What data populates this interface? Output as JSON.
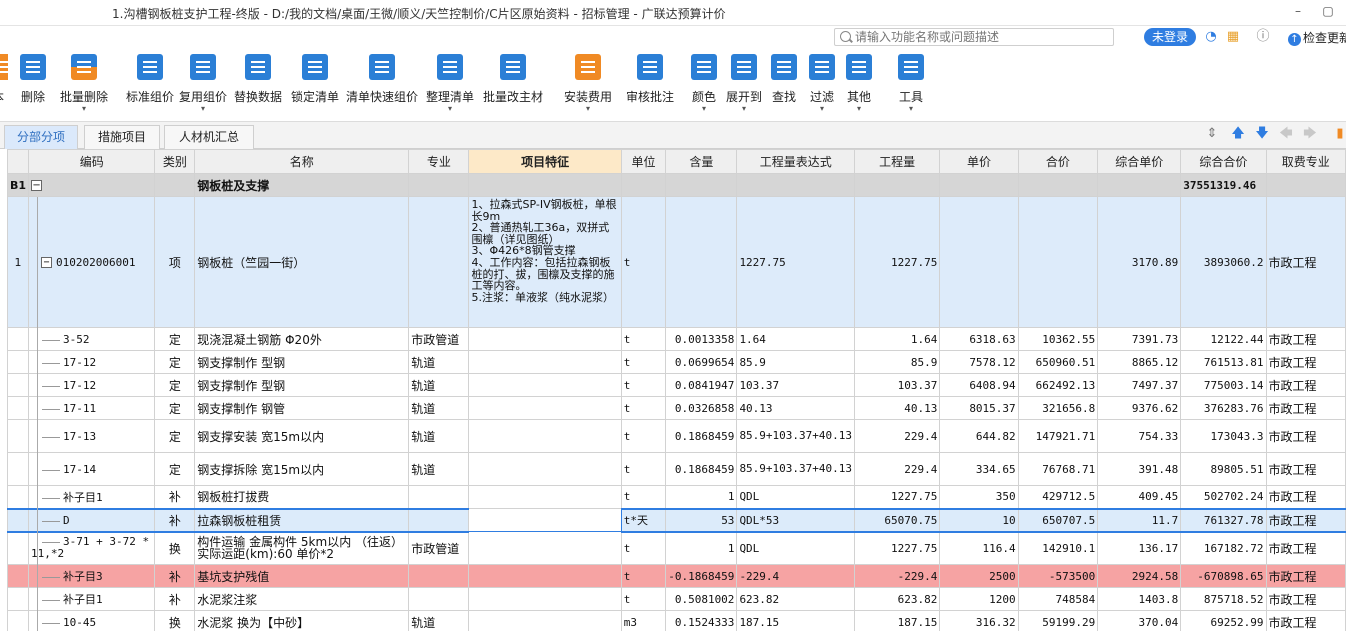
{
  "window": {
    "title": "1.沟槽钢板桩支护工程-终版 - D:/我的文档/桌面/王微/顺义/天竺控制价/C片区原始资料 - 招标管理 - 广联达预算计价",
    "minimize": "–",
    "restore": "▢"
  },
  "header": {
    "search_placeholder": "请输入功能名称或问题描述",
    "login": "未登录",
    "update": "检查更新",
    "update_icon": "arrow-up"
  },
  "toolbar": [
    {
      "label": "删除",
      "icon": "trash-icon"
    },
    {
      "label": "批量删除",
      "icon": "batch-delete-icon"
    },
    {
      "label": "标准组价",
      "icon": "standard-price-icon"
    },
    {
      "label": "复用组价",
      "icon": "reuse-price-icon"
    },
    {
      "label": "替换数据",
      "icon": "replace-icon"
    },
    {
      "label": "锁定清单",
      "icon": "lock-icon"
    },
    {
      "label": "清单快速组价",
      "icon": "quick-price-icon"
    },
    {
      "label": "整理清单",
      "icon": "organize-icon"
    },
    {
      "label": "批量改主材",
      "icon": "edit-material-icon"
    },
    {
      "label": "安装费用",
      "icon": "coins-icon"
    },
    {
      "label": "审核批注",
      "icon": "review-icon"
    },
    {
      "label": "颜色",
      "icon": "paint-bucket-icon"
    },
    {
      "label": "展开到",
      "icon": "expand-icon"
    },
    {
      "label": "查找",
      "icon": "binoculars-icon"
    },
    {
      "label": "过滤",
      "icon": "filter-icon"
    },
    {
      "label": "其他",
      "icon": "grid-icon"
    },
    {
      "label": "工具",
      "icon": "tool-icon"
    }
  ],
  "toolbar_partial": "本",
  "tabs": [
    "分部分项",
    "措施项目",
    "人材机汇总"
  ],
  "columns": [
    "编码",
    "类别",
    "名称",
    "专业",
    "项目特征",
    "单位",
    "含量",
    "工程量表达式",
    "工程量",
    "单价",
    "合价",
    "综合单价",
    "综合合价",
    "取费专业"
  ],
  "section": {
    "no": "B1",
    "expand": "−",
    "name": "钢板桩及支撑",
    "total": "37551319.46"
  },
  "top_item": {
    "no": "1",
    "expand": "−",
    "code": "010202006001",
    "type": "项",
    "name": "钢板桩（竺园一街）",
    "unit": "t",
    "expr": "1227.75",
    "qty": "1227.75",
    "uprice": "3170.89",
    "total": "3893060.2",
    "fee": "市政工程",
    "feature": [
      "1、拉森式SP-IV钢板桩，单根长9m",
      "2、普通热轧工36a，双拼式围檩（详见图纸）",
      "3、Φ426*8钢管支撑",
      "4、工作内容：包括拉森钢板桩的打、拔，围檩及支撑的施工等内容。",
      "5.注浆：单液浆（纯水泥浆）"
    ]
  },
  "rows": [
    {
      "code": "3-52",
      "type": "定",
      "name": "现浇混凝土钢筋 Φ20外",
      "spec": "市政管道",
      "unit": "t",
      "content": "0.0013358",
      "expr": "1.64",
      "qty": "1.64",
      "price": "6318.63",
      "sum": "10362.55",
      "uprice": "7391.73",
      "total": "12122.44",
      "fee": "市政工程"
    },
    {
      "code": "17-12",
      "type": "定",
      "name": "钢支撑制作 型钢",
      "spec": "轨道",
      "unit": "t",
      "content": "0.0699654",
      "expr": "85.9",
      "qty": "85.9",
      "price": "7578.12",
      "sum": "650960.51",
      "uprice": "8865.12",
      "total": "761513.81",
      "fee": "市政工程"
    },
    {
      "code": "17-12",
      "type": "定",
      "name": "钢支撑制作 型钢",
      "spec": "轨道",
      "unit": "t",
      "content": "0.0841947",
      "expr": "103.37",
      "qty": "103.37",
      "price": "6408.94",
      "sum": "662492.13",
      "uprice": "7497.37",
      "total": "775003.14",
      "fee": "市政工程"
    },
    {
      "code": "17-11",
      "type": "定",
      "name": "钢支撑制作 钢管",
      "spec": "轨道",
      "unit": "t",
      "content": "0.0326858",
      "expr": "40.13",
      "qty": "40.13",
      "price": "8015.37",
      "sum": "321656.8",
      "uprice": "9376.62",
      "total": "376283.76",
      "fee": "市政工程"
    },
    {
      "code": "17-13",
      "type": "定",
      "name": "钢支撑安装 宽15m以内",
      "spec": "轨道",
      "unit": "t",
      "content": "0.1868459",
      "expr": "85.9+103.37+40.13",
      "qty": "229.4",
      "price": "644.82",
      "sum": "147921.71",
      "uprice": "754.33",
      "total": "173043.3",
      "fee": "市政工程"
    },
    {
      "code": "17-14",
      "type": "定",
      "name": "钢支撑拆除 宽15m以内",
      "spec": "轨道",
      "unit": "t",
      "content": "0.1868459",
      "expr": "85.9+103.37+40.13",
      "qty": "229.4",
      "price": "334.65",
      "sum": "76768.71",
      "uprice": "391.48",
      "total": "89805.51",
      "fee": "市政工程"
    },
    {
      "code": "补子目1",
      "type": "补",
      "name": "钢板桩打拔费",
      "spec": "",
      "unit": "t",
      "content": "1",
      "expr": "QDL",
      "qty": "1227.75",
      "price": "350",
      "sum": "429712.5",
      "uprice": "409.45",
      "total": "502702.24",
      "fee": "市政工程"
    },
    {
      "code": "D",
      "type": "补",
      "name": "拉森钢板桩租赁",
      "spec": "",
      "unit": "t*天",
      "content": "53",
      "expr": "QDL*53",
      "qty": "65070.75",
      "price": "10",
      "sum": "650707.5",
      "uprice": "11.7",
      "total": "761327.78",
      "fee": "市政工程"
    },
    {
      "code": "3-71 + 3-72 * 11,*2",
      "type": "换",
      "name": "构件运输 金属构件 5km以内 （往返）实际运距(km):60  单价*2",
      "spec": "市政管道",
      "unit": "t",
      "content": "1",
      "expr": "QDL",
      "qty": "1227.75",
      "price": "116.4",
      "sum": "142910.1",
      "uprice": "136.17",
      "total": "167182.72",
      "fee": "市政工程"
    },
    {
      "code": "补子目3",
      "type": "补",
      "name": "基坑支护残值",
      "spec": "",
      "unit": "t",
      "content": "-0.1868459",
      "expr": "-229.4",
      "qty": "-229.4",
      "price": "2500",
      "sum": "-573500",
      "uprice": "2924.58",
      "total": "-670898.65",
      "fee": "市政工程"
    },
    {
      "code": "补子目1",
      "type": "补",
      "name": "水泥浆注浆",
      "spec": "",
      "unit": "t",
      "content": "0.5081002",
      "expr": "623.82",
      "qty": "623.82",
      "price": "1200",
      "sum": "748584",
      "uprice": "1403.8",
      "total": "875718.52",
      "fee": "市政工程"
    },
    {
      "code": "10-45",
      "type": "换",
      "name": "水泥浆  换为【中砂】",
      "spec": "轨道",
      "unit": "m3",
      "content": "0.1524333",
      "expr": "187.15",
      "qty": "187.15",
      "price": "316.32",
      "sum": "59199.29",
      "uprice": "370.04",
      "total": "69252.99",
      "fee": "市政工程"
    }
  ],
  "colors": {
    "accent": "#2f7de1",
    "section_bg": "#d6d6d6",
    "top_bg": "#ddebfa",
    "selected_border": "#2f7de1",
    "red_row": "#f6a3a3"
  }
}
